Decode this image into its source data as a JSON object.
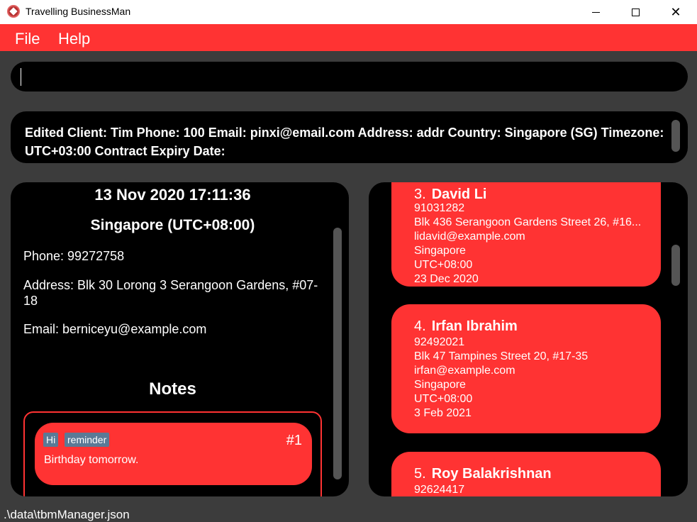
{
  "window": {
    "title": "Travelling BusinessMan",
    "minimize_glyph": "",
    "close_glyph": "✕"
  },
  "menu": {
    "file_label": "File",
    "help_label": "Help"
  },
  "command": {
    "value": ""
  },
  "result": {
    "text": "Edited Client: Tim Phone: 100 Email: pinxi@email.com Address: addr Country: Singapore (SG) Timezone: UTC+03:00 Contract Expiry Date:"
  },
  "detail": {
    "time": "13 Nov 2020 17:11:36",
    "country_timezone": "Singapore (UTC+08:00)",
    "phone": "Phone: 99272758",
    "address": "Address: Blk 30 Lorong 3 Serangoon Gardens, #07-18",
    "email": "Email: berniceyu@example.com",
    "notes_title": "Notes",
    "notes": [
      {
        "tags": [
          "Hi",
          "reminder"
        ],
        "index": "#1",
        "text": "Birthday tomorrow."
      }
    ]
  },
  "clients": [
    {
      "index": "3.",
      "name": "David Li",
      "phone": "91031282",
      "address": "Blk 436 Serangoon Gardens Street 26, #16...",
      "email": "lidavid@example.com",
      "country": "Singapore",
      "timezone": "UTC+08:00",
      "expiry": "23 Dec 2020"
    },
    {
      "index": "4.",
      "name": "Irfan Ibrahim",
      "phone": "92492021",
      "address": "Blk 47 Tampines Street 20, #17-35",
      "email": "irfan@example.com",
      "country": "Singapore",
      "timezone": "UTC+08:00",
      "expiry": "3 Feb 2021"
    },
    {
      "index": "5.",
      "name": "Roy Balakrishnan",
      "phone": "92624417"
    }
  ],
  "status": {
    "file_path": ".\\data\\tbmManager.json"
  },
  "colors": {
    "accent": "#ff3333",
    "panel": "#000000",
    "background": "#3c3c3c",
    "tag": "#5a7a96"
  }
}
